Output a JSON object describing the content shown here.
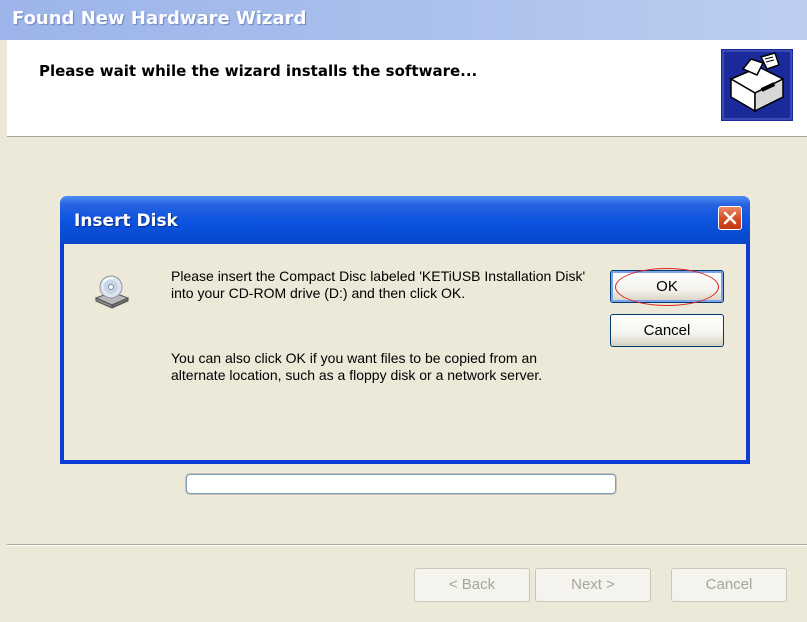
{
  "wizard": {
    "title": "Found New Hardware Wizard",
    "header_text": "Please wait while the wizard installs the software...",
    "header_icon": "hardware-install-icon",
    "progress_fraction": 0.0,
    "buttons": {
      "back": "< Back",
      "next": "Next >",
      "cancel": "Cancel"
    }
  },
  "dialog": {
    "title": "Insert Disk",
    "message_line1": "Please insert the Compact Disc labeled 'KETiUSB Installation Disk' into your CD-ROM drive (D:) and then click OK.",
    "message_line2": "You can also click OK if you want files to be copied from an alternate location, such as a floppy disk or a network server.",
    "icon": "cd-drive-icon",
    "ok_label": "OK",
    "cancel_label": "Cancel",
    "close_icon": "close-icon"
  },
  "colors": {
    "dialog_border": "#0b3cd5",
    "annotation_circle": "#e02020",
    "face": "#ece9d8"
  }
}
